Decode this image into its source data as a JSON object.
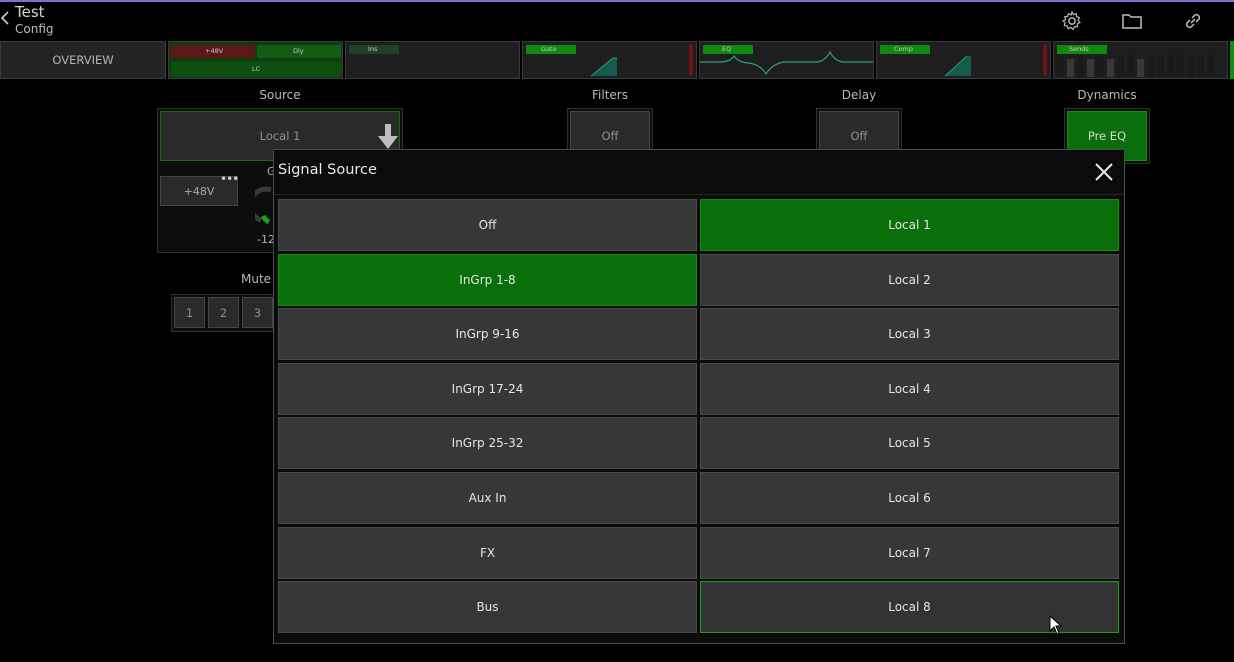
{
  "header": {
    "title": "Test",
    "subtitle": "Config",
    "icons": [
      "settings-icon",
      "folder-icon",
      "link-icon"
    ]
  },
  "strip": {
    "overview_label": "OVERVIEW",
    "preamp": {
      "phantom": "+48V",
      "delay": "Dly",
      "lowcut": "LC"
    },
    "ins_label": "Ins",
    "gate_label": "Gate",
    "eq_label": "EQ",
    "comp_label": "Comp",
    "sends_label": "Sends"
  },
  "sections": {
    "source": {
      "label": "Source",
      "value": "Local 1"
    },
    "filters": {
      "label": "Filters",
      "value": "Off"
    },
    "delay": {
      "label": "Delay",
      "value": "Off"
    },
    "dynamics": {
      "label": "Dynamics",
      "value": "Pre EQ"
    },
    "phantom_button": "+48V",
    "gain_partial": "G",
    "gain_value_partial": "-12",
    "mute_label_partial": "Mute g",
    "mute_groups": [
      "1",
      "2",
      "3"
    ]
  },
  "modal": {
    "title": "Signal Source",
    "left_options": [
      "Off",
      "InGrp 1-8",
      "InGrp 9-16",
      "InGrp 17-24",
      "InGrp 25-32",
      "Aux In",
      "FX",
      "Bus"
    ],
    "right_options": [
      "Local 1",
      "Local 2",
      "Local 3",
      "Local 4",
      "Local 5",
      "Local 6",
      "Local 7",
      "Local 8"
    ],
    "selected_left": "InGrp 1-8",
    "selected_right": "Local 1",
    "focused_right": "Local 8"
  },
  "colors": {
    "selected": "#0a6f0a",
    "accent_green": "#0e8f0e",
    "button": "#373737",
    "top_line": "#7c71c9"
  }
}
